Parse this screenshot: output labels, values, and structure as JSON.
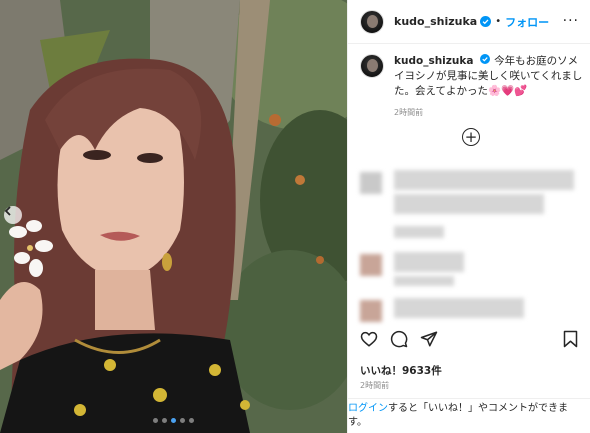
{
  "account": {
    "username": "kudo_shizuka",
    "separator": "•",
    "follow_label": "フォロー",
    "more_label": "···"
  },
  "caption": {
    "username": "kudo_shizuka",
    "text": "今年もお庭のソメイヨシノが見事に美しく咲いてくれました。会えてよかった",
    "emoji": "🌸💗💕",
    "time": "2時間前"
  },
  "load_more_label": "+",
  "likes": "いいね！9633件",
  "post_time": "2時間前",
  "login_prompt": {
    "link": "ログイン",
    "rest": "すると「いいね！」やコメントができます。"
  },
  "colors": {
    "link": "#0095f6",
    "verified": "#0095f6",
    "text": "#262626",
    "muted": "#8e8e8e"
  }
}
